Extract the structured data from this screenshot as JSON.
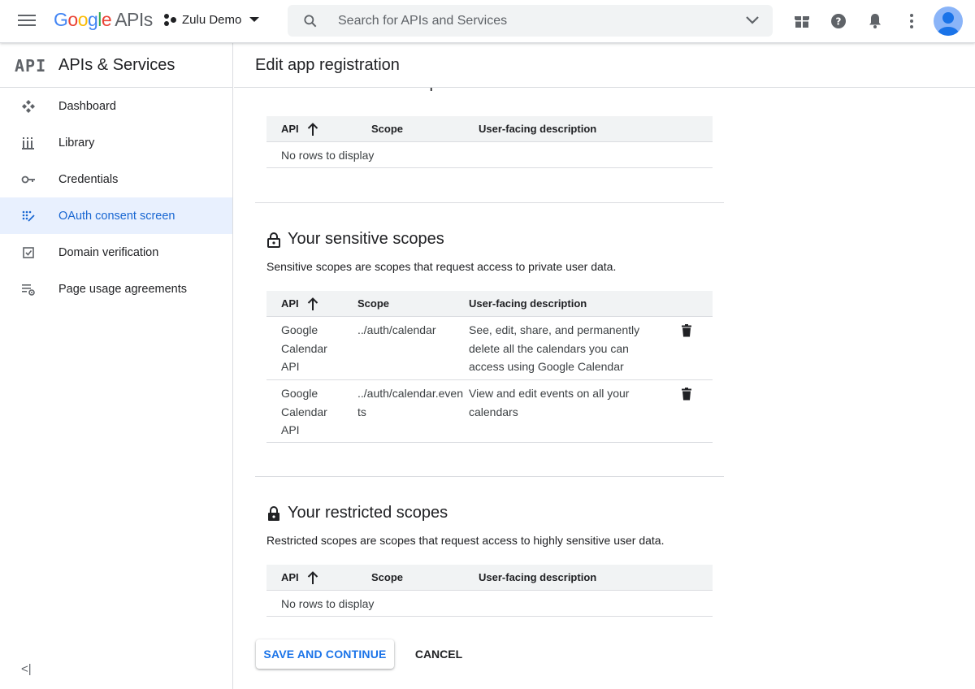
{
  "topbar": {
    "logo_google": [
      "G",
      "o",
      "o",
      "g",
      "l",
      "e"
    ],
    "logo_apis": "APIs",
    "project_name": "Zulu Demo",
    "search_placeholder": "Search for APIs and Services"
  },
  "sidebar": {
    "api_mark": "API",
    "title": "APIs & Services",
    "items": [
      {
        "label": "Dashboard",
        "icon": "dashboard-icon"
      },
      {
        "label": "Library",
        "icon": "library-icon"
      },
      {
        "label": "Credentials",
        "icon": "key-icon"
      },
      {
        "label": "OAuth consent screen",
        "icon": "oauth-icon",
        "active": true
      },
      {
        "label": "Domain verification",
        "icon": "checkbox-icon"
      },
      {
        "label": "Page usage agreements",
        "icon": "settings-list-icon"
      }
    ],
    "collapse_label": "<|"
  },
  "main": {
    "title": "Edit app registration",
    "non_sensitive": {
      "title": "Your non-sensitive scopes",
      "headers": {
        "api": "API",
        "scope": "Scope",
        "desc": "User-facing description"
      },
      "empty": "No rows to display"
    },
    "sensitive": {
      "title": "Your sensitive scopes",
      "description": "Sensitive scopes are scopes that request access to private user data.",
      "headers": {
        "api": "API",
        "scope": "Scope",
        "desc": "User-facing description"
      },
      "rows": [
        {
          "api": "Google Calendar API",
          "scope": "../auth/calendar",
          "desc": "See, edit, share, and permanently delete all the calendars you can access using Google Calendar"
        },
        {
          "api": "Google Calendar API",
          "scope": "../auth/calendar.events",
          "desc": "View and edit events on all your calendars"
        }
      ]
    },
    "restricted": {
      "title": "Your restricted scopes",
      "description": "Restricted scopes are scopes that request access to highly sensitive user data.",
      "headers": {
        "api": "API",
        "scope": "Scope",
        "desc": "User-facing description"
      },
      "empty": "No rows to display"
    },
    "buttons": {
      "save": "SAVE AND CONTINUE",
      "cancel": "CANCEL"
    }
  }
}
